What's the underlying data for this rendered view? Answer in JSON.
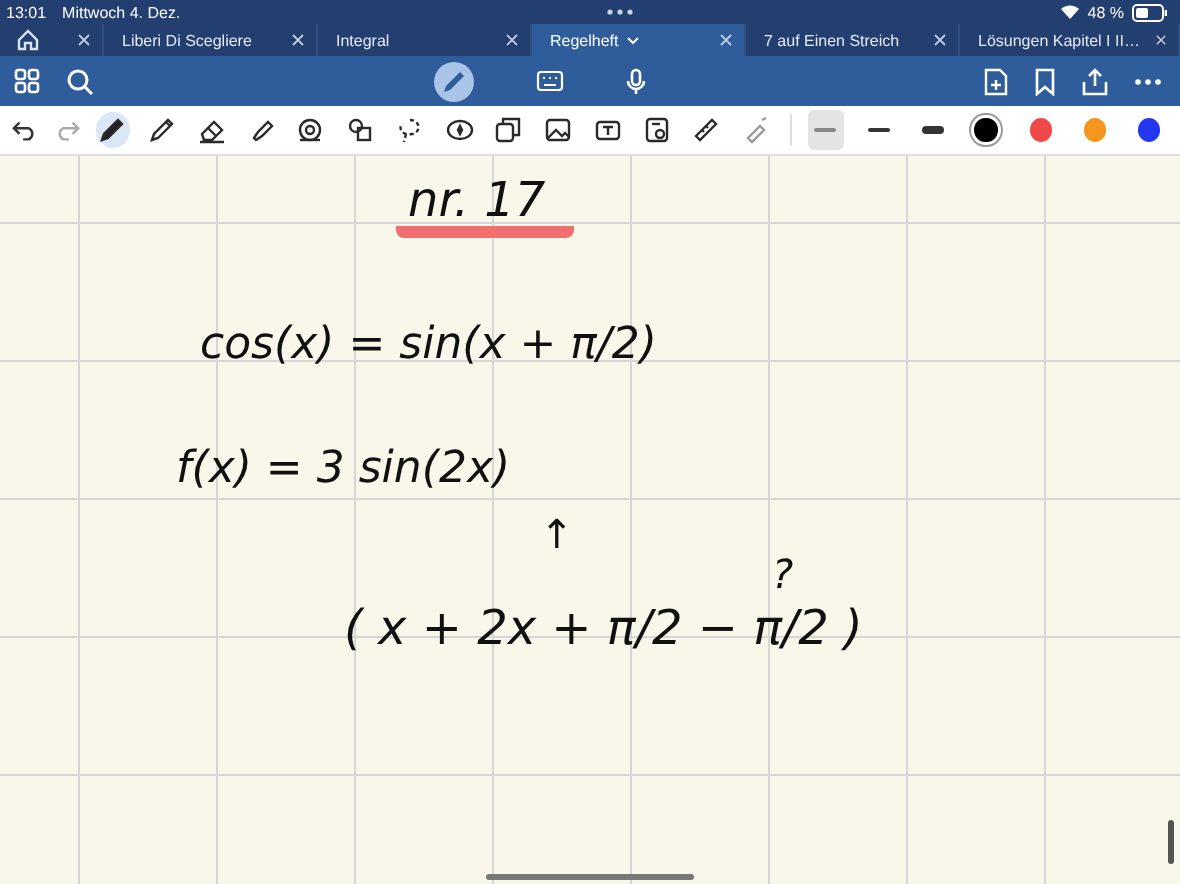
{
  "status_bar": {
    "time": "13:01",
    "date": "Mittwoch 4. Dez.",
    "battery": "48 %"
  },
  "tabs": [
    {
      "label": "Liberi Di Scegliere",
      "selected": false
    },
    {
      "label": "Integral",
      "selected": false
    },
    {
      "label": "Regelheft",
      "selected": true
    },
    {
      "label": "7 auf Einen Streich",
      "selected": false
    },
    {
      "label": "Lösungen Kapitel I II…",
      "selected": false
    }
  ],
  "tools": [
    {
      "kind": "pen",
      "selected": true
    },
    {
      "kind": "pencil",
      "selected": false
    },
    {
      "kind": "eraser",
      "selected": false
    },
    {
      "kind": "highlighter",
      "selected": false
    },
    {
      "kind": "shape",
      "selected": false
    },
    {
      "kind": "shapes",
      "selected": false
    },
    {
      "kind": "lasso",
      "selected": false
    },
    {
      "kind": "sticker",
      "selected": false
    },
    {
      "kind": "copy",
      "selected": false
    },
    {
      "kind": "image",
      "selected": false
    },
    {
      "kind": "textbox",
      "selected": false
    },
    {
      "kind": "scan",
      "selected": false
    },
    {
      "kind": "ruler",
      "selected": false
    },
    {
      "kind": "laser",
      "selected": false
    }
  ],
  "widths": [
    {
      "kind": "thin",
      "selected": true
    },
    {
      "kind": "medium",
      "selected": false
    },
    {
      "kind": "thick",
      "selected": false
    }
  ],
  "colors": [
    {
      "color": "#000000",
      "selected": true
    },
    {
      "color": "#f04848",
      "selected": false
    },
    {
      "color": "#f5961f",
      "selected": false
    },
    {
      "color": "#2536f2",
      "selected": false
    }
  ],
  "handwriting": [
    {
      "text": "nr. 17",
      "kind": "heading"
    },
    {
      "text": "cos(x) = sin(x + π/2)",
      "kind": "line"
    },
    {
      "text": "f(x) =  3 sin(2x)",
      "kind": "line"
    },
    {
      "text": "↑",
      "kind": "mark"
    },
    {
      "text": "?",
      "kind": "mark"
    },
    {
      "text": "( x + 2x + π/2 − π/2 )",
      "kind": "line"
    }
  ]
}
